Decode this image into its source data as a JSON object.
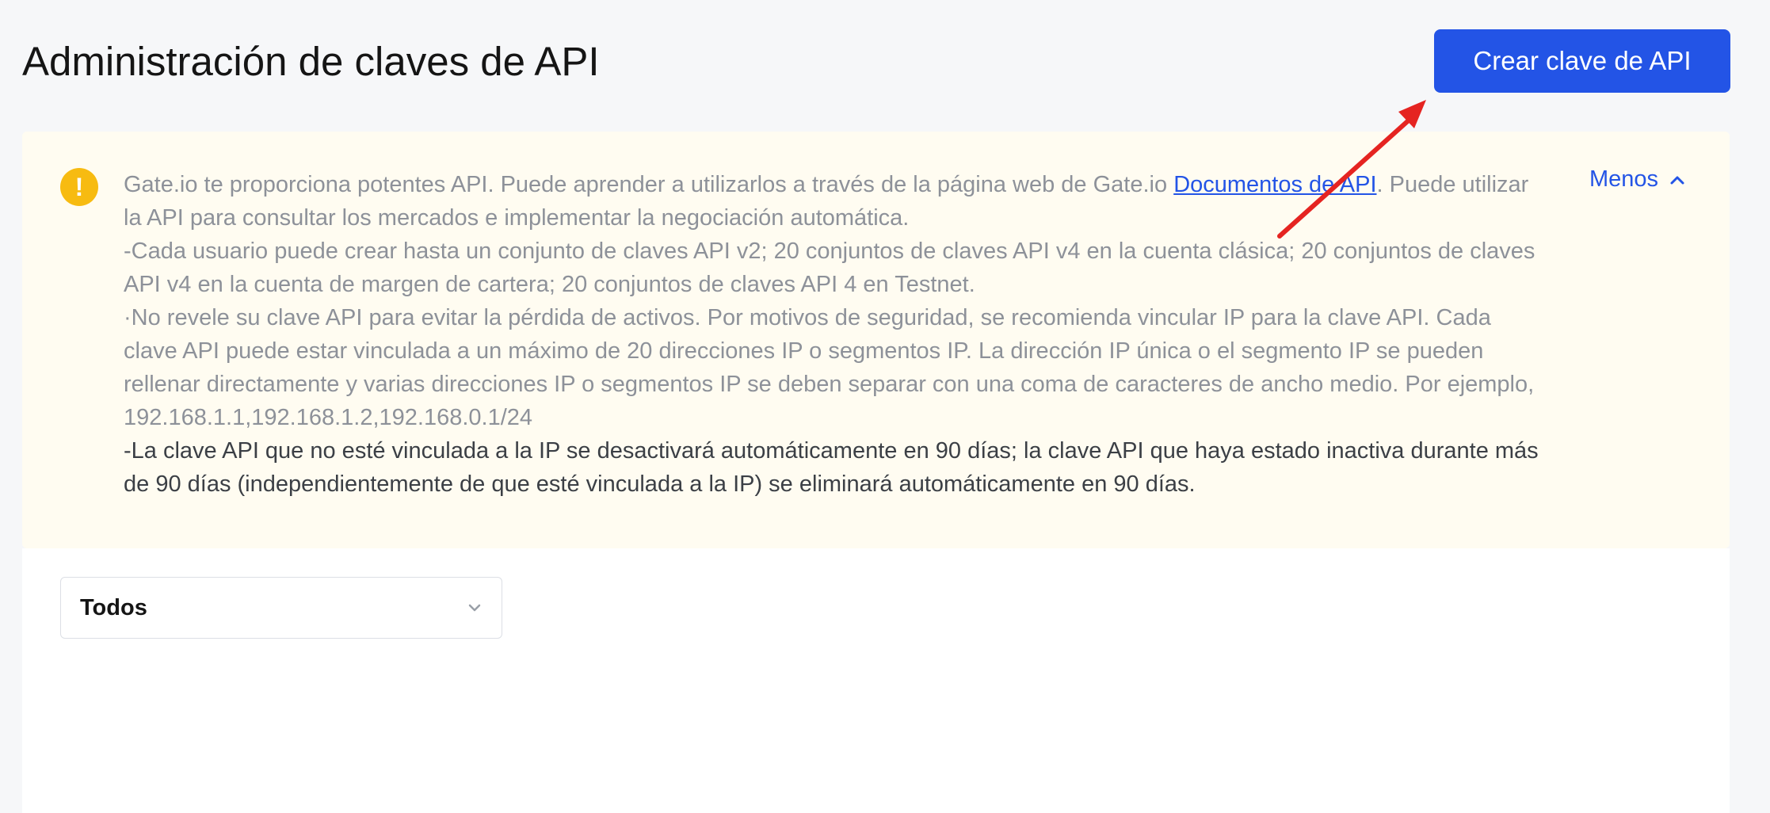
{
  "header": {
    "title": "Administración de claves de API",
    "create_button_label": "Crear clave de API"
  },
  "notice": {
    "paragraph1_before_link": "Gate.io te proporciona potentes API. Puede aprender a utilizarlos a través de la página web de Gate.io ",
    "link_text": "Documentos de API",
    "paragraph1_after_link": ". Puede utilizar la API para consultar los mercados e implementar la negociación automática.",
    "paragraph2": "-Cada usuario puede crear hasta un conjunto de claves API v2; 20 conjuntos de claves API v4 en la cuenta clásica; 20 conjuntos de claves API v4 en la cuenta de margen de cartera; 20 conjuntos de claves API 4 en Testnet.",
    "paragraph3": "·No revele su clave API para evitar la pérdida de activos. Por motivos de seguridad, se recomienda vincular IP para la clave API. Cada clave API puede estar vinculada a un máximo de 20 direcciones IP o segmentos IP. La dirección IP única o el segmento IP se pueden rellenar directamente y varias direcciones IP o segmentos IP se deben separar con una coma de caracteres de ancho medio. Por ejemplo, 192.168.1.1,192.168.1.2,192.168.0.1/24",
    "paragraph4": "-La clave API que no esté vinculada a la IP se desactivará automáticamente en 90 días; la clave API que haya estado inactiva durante más de 90 días (independientemente de que esté vinculada a la IP) se eliminará automáticamente en 90 días.",
    "toggle_label": "Menos",
    "icon": "warning-icon"
  },
  "filter": {
    "selected": "Todos",
    "icon": "chevron-down-icon"
  },
  "colors": {
    "primary": "#2354e6",
    "warning": "#f7bb11",
    "notice_background": "#fffcf1",
    "annotation_arrow": "#e52421"
  }
}
